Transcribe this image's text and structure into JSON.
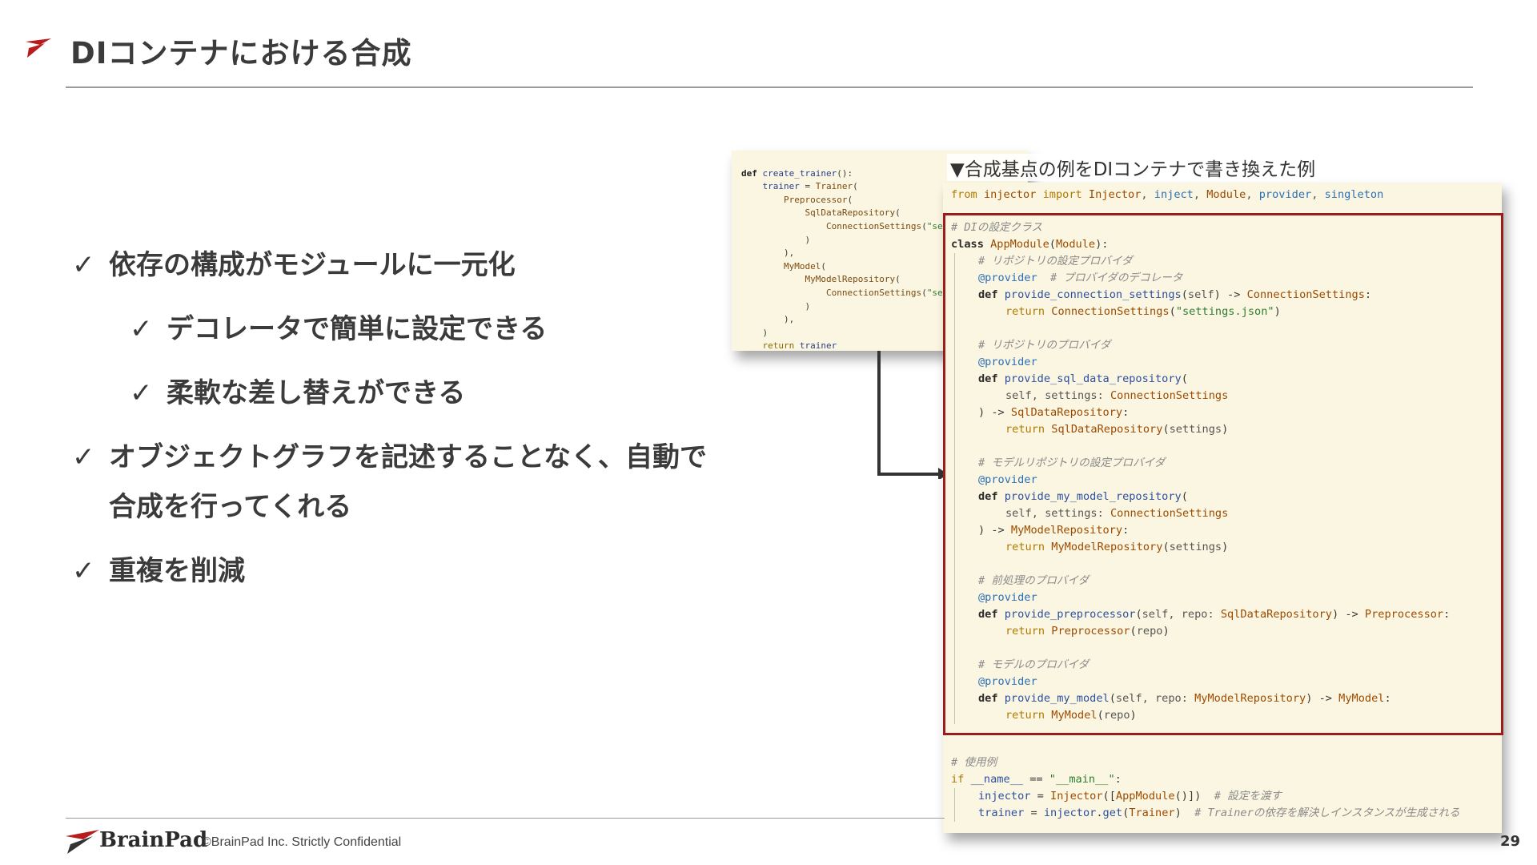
{
  "header": {
    "logo_icon": "brainpad-mark-icon",
    "title": "DIコンテナにおける合成"
  },
  "bullets": [
    {
      "level": 1,
      "check": "✓",
      "text": "依存の構成がモジュールに一元化"
    },
    {
      "level": 2,
      "check": "✓",
      "text": "デコレータで簡単に設定できる"
    },
    {
      "level": 2,
      "check": "✓",
      "text": "柔軟な差し替えができる"
    },
    {
      "level": 1,
      "check": "✓",
      "text": "オブジェクトグラフを記述することなく、自動で合成を行ってくれる"
    },
    {
      "level": 1,
      "check": "✓",
      "text": "重複を削減"
    }
  ],
  "code_small": {
    "lines": [
      "def create_trainer():",
      "    trainer = Trainer(",
      "        Preprocessor(",
      "            SqlDataRepository(",
      "                ConnectionSettings(\"se",
      "            )",
      "        ),",
      "        MyModel(",
      "            MyModelRepository(",
      "                ConnectionSettings(\"se",
      "            )",
      "        ),",
      "    )",
      "    return trainer"
    ]
  },
  "code_caption": "▼合成基点の例をDIコンテナで書き換えた例",
  "code_main": {
    "import_line": "from injector import Injector, inject, Module, provider, singleton",
    "lines": [
      "# DIの設定クラス",
      "class AppModule(Module):",
      "    # リポジトリの設定プロバイダ",
      "    @provider  # プロバイダのデコレータ",
      "    def provide_connection_settings(self) -> ConnectionSettings:",
      "        return ConnectionSettings(\"settings.json\")",
      "",
      "    # リポジトリのプロバイダ",
      "    @provider",
      "    def provide_sql_data_repository(",
      "        self, settings: ConnectionSettings",
      "    ) -> SqlDataRepository:",
      "        return SqlDataRepository(settings)",
      "",
      "    # モデルリポジトリの設定プロバイダ",
      "    @provider",
      "    def provide_my_model_repository(",
      "        self, settings: ConnectionSettings",
      "    ) -> MyModelRepository:",
      "        return MyModelRepository(settings)",
      "",
      "    # 前処理のプロバイダ",
      "    @provider",
      "    def provide_preprocessor(self, repo: SqlDataRepository) -> Preprocessor:",
      "        return Preprocessor(repo)",
      "",
      "    # モデルのプロバイダ",
      "    @provider",
      "    def provide_my_model(self, repo: MyModelRepository) -> MyModel:",
      "        return MyModel(repo)"
    ],
    "usage_lines": [
      "# 使用例",
      "if __name__ == \"__main__\":",
      "    injector = Injector([AppModule()])  # 設定を渡す",
      "    trainer = injector.get(Trainer)  # Trainerの依存を解決しインスタンスが生成される"
    ]
  },
  "footer": {
    "logo_text": "BrainPad",
    "copyright": "©BrainPad Inc.  Strictly Confidential",
    "page_number": "29"
  },
  "colors": {
    "accent_red": "#9c1b1b",
    "code_bg": "#fbf6e1",
    "title_text": "#3b3b3b"
  }
}
